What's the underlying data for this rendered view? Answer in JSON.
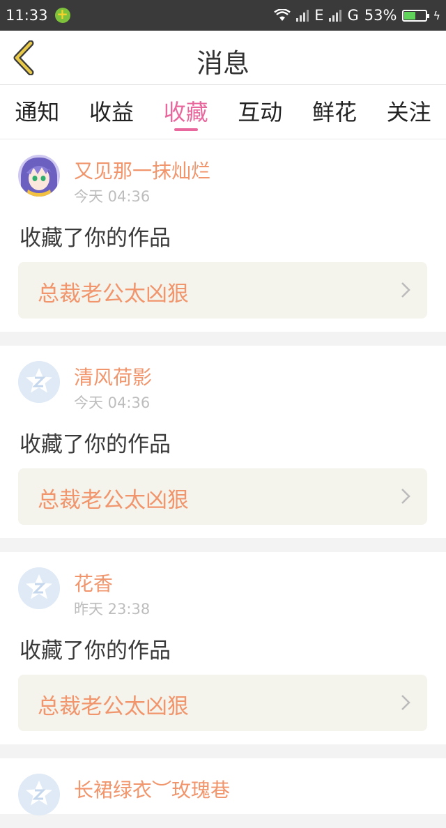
{
  "status_bar": {
    "time": "11:33",
    "network_e": "E",
    "network_g": "G",
    "battery_percent": "53%",
    "battery_level": 0.53
  },
  "header": {
    "title": "消息"
  },
  "tabs": [
    {
      "label": "通知",
      "active": false
    },
    {
      "label": "收益",
      "active": false
    },
    {
      "label": "收藏",
      "active": true
    },
    {
      "label": "互动",
      "active": false
    },
    {
      "label": "鲜花",
      "active": false
    },
    {
      "label": "关注",
      "active": false
    }
  ],
  "messages": [
    {
      "username": "又见那一抹灿烂",
      "time": "今天 04:36",
      "action": "收藏了你的作品",
      "work_title": "总裁老公太凶狠",
      "avatar": "anime-avatar"
    },
    {
      "username": "清风荷影",
      "time": "今天 04:36",
      "action": "收藏了你的作品",
      "work_title": "总裁老公太凶狠",
      "avatar": "qq-default-avatar"
    },
    {
      "username": "花香",
      "time": "昨天 23:38",
      "action": "收藏了你的作品",
      "work_title": "总裁老公太凶狠",
      "avatar": "qq-default-avatar"
    },
    {
      "username": "长裙绿衣︶玫瑰巷",
      "time": "",
      "action": "",
      "work_title": "",
      "avatar": "qq-default-avatar"
    }
  ],
  "colors": {
    "accent_pink": "#e8689d",
    "username_orange": "#f0956c",
    "status_bar_bg": "#3a3a3a",
    "work_link_bg": "#f4f3ec",
    "back_arrow": "#e8c94a"
  }
}
